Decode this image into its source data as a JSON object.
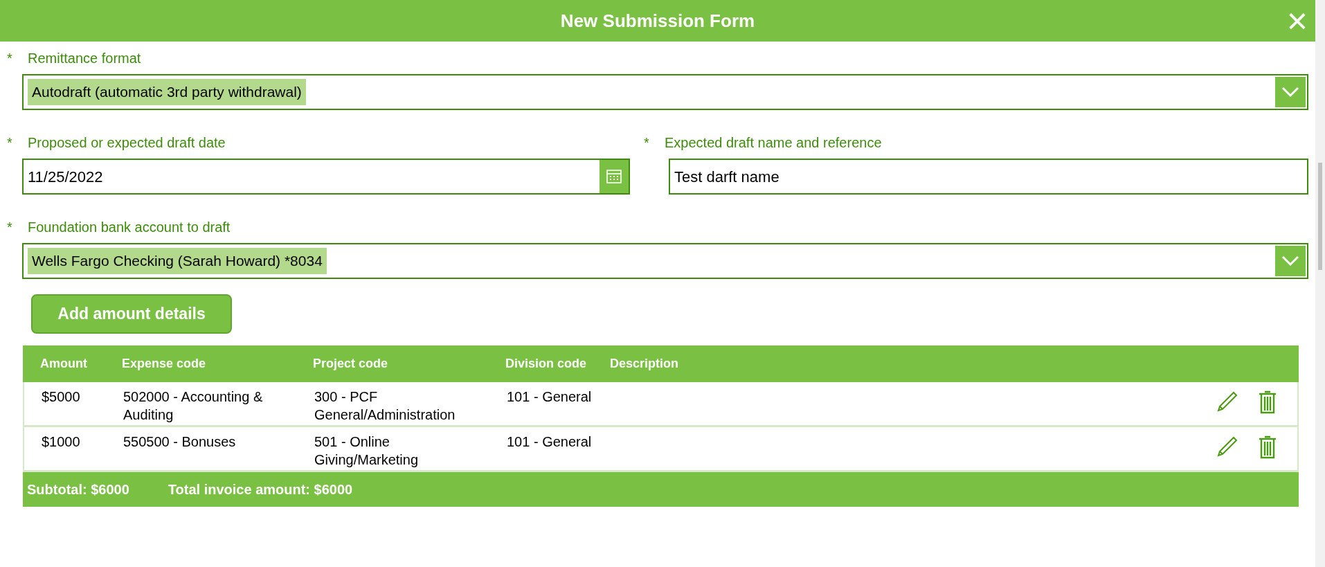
{
  "window": {
    "title": "New Submission Form",
    "close": "×"
  },
  "required_mark": "*",
  "fields": [
    {
      "kind": "dropdown",
      "required": true,
      "label": "Remittance format",
      "value": "Autodraft (automatic 3rd party withdrawal)"
    },
    {
      "kind": "date",
      "required": true,
      "label": "Proposed or expected draft date",
      "value": "11/25/2022"
    },
    {
      "kind": "text",
      "required": true,
      "label": "Expected draft name and reference",
      "value": "Test darft name"
    },
    {
      "kind": "dropdown",
      "required": true,
      "label": "Foundation bank account to draft",
      "value": "Wells Fargo Checking (Sarah Howard) *8034"
    }
  ],
  "add_button": "Add amount details",
  "table": {
    "columns": [
      "Amount",
      "Expense code",
      "Project code",
      "Division code",
      "Description"
    ],
    "rows": [
      {
        "cells": [
          "$5000",
          "502000 - Accounting & Auditing",
          "300 - PCF General/Administration",
          "101 - General"
        ]
      },
      {
        "cells": [
          "$1000",
          "550500 - Bonuses",
          "501 - Online Giving/Marketing",
          "101 - General"
        ]
      }
    ],
    "subtotal": "Subtotal: $6000",
    "total": "Total invoice amount: $6000"
  }
}
